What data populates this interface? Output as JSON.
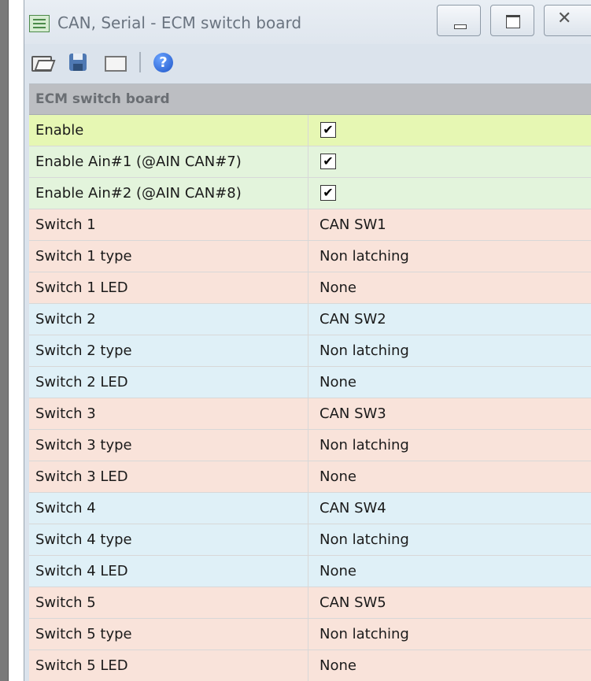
{
  "window": {
    "title": "CAN, Serial - ECM switch board",
    "close_glyph": "✕",
    "help_glyph": "?"
  },
  "toolbar": {
    "items": [
      "open-folder-icon",
      "save-disk-icon",
      "window-icon",
      "help-icon"
    ]
  },
  "grid": {
    "section": "ECM switch board",
    "rows": [
      {
        "name": "Enable",
        "checked": true,
        "check_glyph": "✔",
        "color": "#e6f7b3"
      },
      {
        "name": "Enable Ain#1 (@AIN CAN#7)",
        "checked": true,
        "check_glyph": "✔",
        "color": "#e3f4dc"
      },
      {
        "name": "Enable Ain#2 (@AIN CAN#8)",
        "checked": true,
        "check_glyph": "✔",
        "color": "#e3f4dc"
      },
      {
        "name": "Switch 1",
        "value": "CAN SW1",
        "color": "#f9e3da"
      },
      {
        "name": "Switch 1 type",
        "value": "Non latching",
        "color": "#f9e3da"
      },
      {
        "name": "Switch 1 LED",
        "value": "None",
        "color": "#f9e3da"
      },
      {
        "name": "Switch 2",
        "value": "CAN SW2",
        "color": "#dff0f7"
      },
      {
        "name": "Switch 2 type",
        "value": "Non latching",
        "color": "#dff0f7"
      },
      {
        "name": "Switch 2 LED",
        "value": "None",
        "color": "#dff0f7"
      },
      {
        "name": "Switch 3",
        "value": "CAN SW3",
        "color": "#f9e3da"
      },
      {
        "name": "Switch 3 type",
        "value": "Non latching",
        "color": "#f9e3da"
      },
      {
        "name": "Switch 3 LED",
        "value": "None",
        "color": "#f9e3da"
      },
      {
        "name": "Switch 4",
        "value": "CAN SW4",
        "color": "#dff0f7"
      },
      {
        "name": "Switch 4 type",
        "value": "Non latching",
        "color": "#dff0f7"
      },
      {
        "name": "Switch 4 LED",
        "value": "None",
        "color": "#dff0f7"
      },
      {
        "name": "Switch 5",
        "value": "CAN SW5",
        "color": "#f9e3da"
      },
      {
        "name": "Switch 5 type",
        "value": "Non latching",
        "color": "#f9e3da"
      },
      {
        "name": "Switch 5 LED",
        "value": "None",
        "color": "#f9e3da"
      }
    ]
  }
}
